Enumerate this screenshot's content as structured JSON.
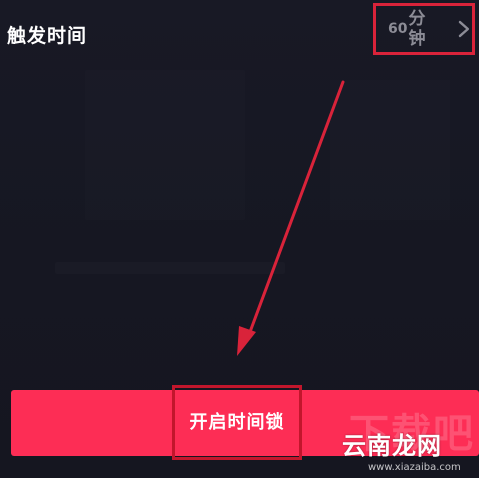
{
  "trigger_setting": {
    "label": "触发时间",
    "value_number": "60",
    "value_unit": "分钟",
    "chevron_icon": "chevron-right-icon"
  },
  "primary_action": {
    "label": "开启时间锁"
  },
  "annotation": {
    "highlight_color": "#d9233a",
    "arrow_color": "#d9233a"
  },
  "theme": {
    "background": "#161722",
    "button_color": "#fd2d55",
    "secondary_text": "#8c8c96"
  },
  "watermark": {
    "ghost_text": "下载吧",
    "main_text": "云南龙网",
    "sub_text": "www.xiazaiba.com"
  }
}
